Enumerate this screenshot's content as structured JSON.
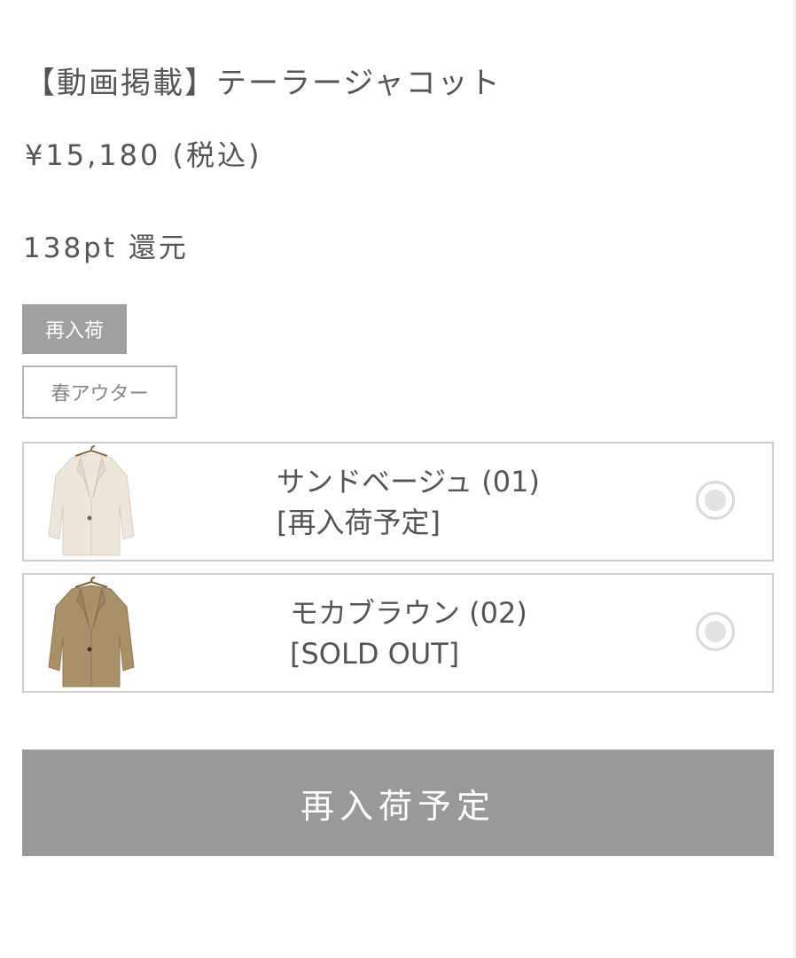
{
  "product": {
    "title": "【動画掲載】テーラージャコット",
    "price": "¥15,180 (税込)",
    "points": "138pt 還元"
  },
  "tags": {
    "restock": "再入荷",
    "category": "春アウター"
  },
  "variants": [
    {
      "name": "サンドベージュ (01)",
      "status": "[再入荷予定]",
      "thumbnail_icon": "beige-jacket-image",
      "jacket_color": "#ece6dc"
    },
    {
      "name": "モカブラウン (02)",
      "status": "[SOLD OUT]",
      "thumbnail_icon": "brown-jacket-image",
      "jacket_color": "#a89069"
    }
  ],
  "cta": {
    "label": "再入荷予定"
  },
  "colors": {
    "text": "#555555",
    "tag_filled_bg": "#a0a0a0",
    "cta_bg": "#999999",
    "border": "#cfcfcf"
  }
}
